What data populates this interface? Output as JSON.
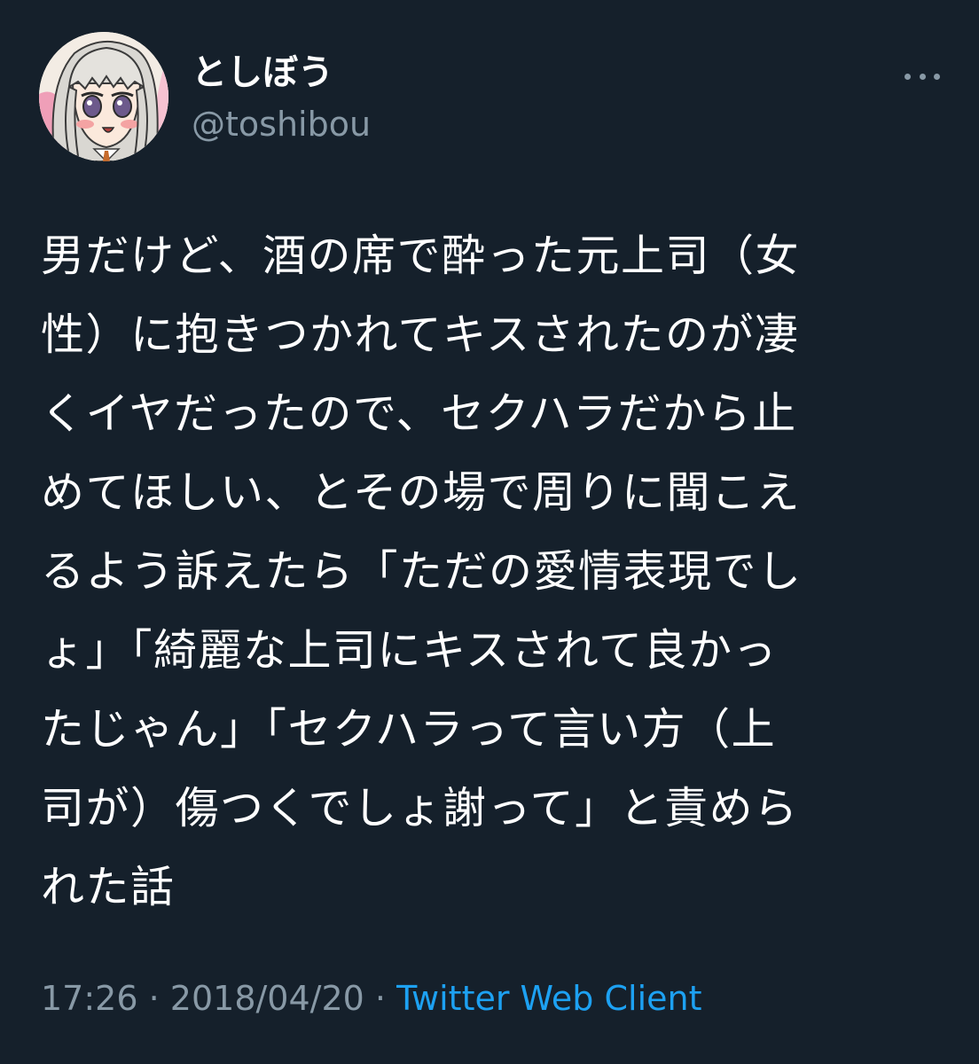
{
  "author": {
    "display_name": "としぼう",
    "handle": "@toshibou"
  },
  "tweet": {
    "lines": [
      "男だけど、酒の席で酔った元上司（女",
      "性）に抱きつかれてキスされたのが凄",
      "くイヤだったので、セクハラだから止",
      "めてほしい、とその場で周りに聞こえ",
      "るよう訴えたら「ただの愛情表現でし",
      "ょ」「綺麗な上司にキスされて良かっ",
      "たじゃん」「セクハラって言い方（上",
      "司が）傷つくでしょ謝って」と責めら",
      "れた話"
    ]
  },
  "meta": {
    "time": "17:26",
    "separator": "·",
    "date": "2018/04/20",
    "client": "Twitter Web Client"
  },
  "colors": {
    "background": "#15202b",
    "text": "#ffffff",
    "muted": "#8899a6",
    "link": "#1da1f2"
  },
  "icons": {
    "more": "more-dots-icon"
  }
}
